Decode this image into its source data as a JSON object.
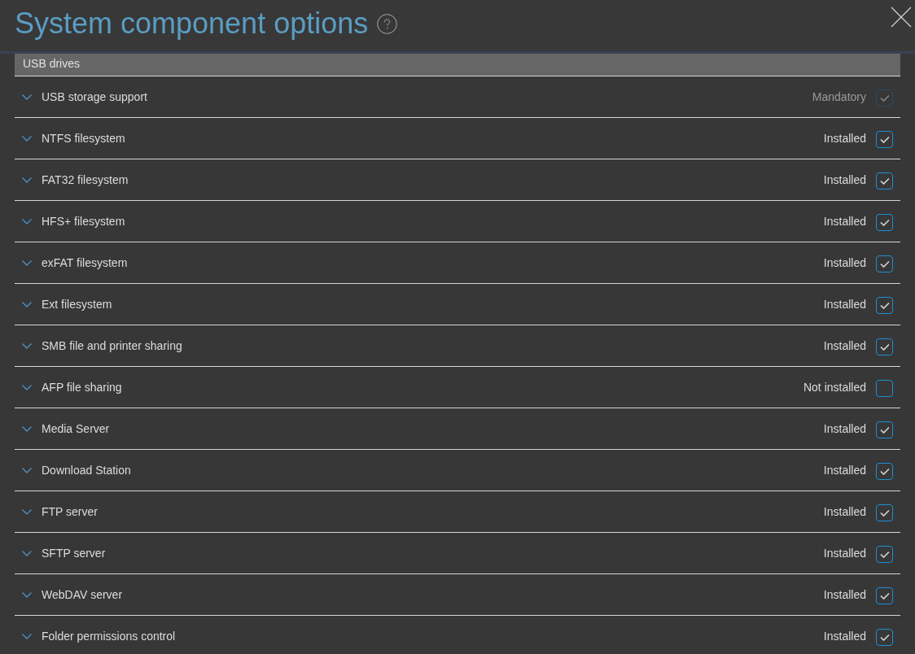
{
  "dialog": {
    "title": "System component options"
  },
  "section": {
    "title": "USB drives"
  },
  "components": [
    {
      "name": "USB storage support",
      "status": "Mandatory",
      "checked": true,
      "disabled": true,
      "expanded": false
    },
    {
      "name": "NTFS filesystem",
      "status": "Installed",
      "checked": true,
      "disabled": false,
      "expanded": false
    },
    {
      "name": "FAT32 filesystem",
      "status": "Installed",
      "checked": true,
      "disabled": false,
      "expanded": false
    },
    {
      "name": "HFS+ filesystem",
      "status": "Installed",
      "checked": true,
      "disabled": false,
      "expanded": false
    },
    {
      "name": "exFAT filesystem",
      "status": "Installed",
      "checked": true,
      "disabled": false,
      "expanded": false
    },
    {
      "name": "Ext filesystem",
      "status": "Installed",
      "checked": true,
      "disabled": false,
      "expanded": false
    },
    {
      "name": "SMB file and printer sharing",
      "status": "Installed",
      "checked": true,
      "disabled": false,
      "expanded": false
    },
    {
      "name": "AFP file sharing",
      "status": "Not installed",
      "checked": false,
      "disabled": false,
      "expanded": false
    },
    {
      "name": "Media Server",
      "status": "Installed",
      "checked": true,
      "disabled": false,
      "expanded": false
    },
    {
      "name": "Download Station",
      "status": "Installed",
      "checked": true,
      "disabled": false,
      "expanded": false
    },
    {
      "name": "FTP server",
      "status": "Installed",
      "checked": true,
      "disabled": false,
      "expanded": false
    },
    {
      "name": "SFTP server",
      "status": "Installed",
      "checked": true,
      "disabled": false,
      "expanded": false
    },
    {
      "name": "WebDAV server",
      "status": "Installed",
      "checked": true,
      "disabled": false,
      "expanded": false
    },
    {
      "name": "Folder permissions control",
      "status": "Installed",
      "checked": true,
      "disabled": false,
      "expanded": false
    }
  ]
}
